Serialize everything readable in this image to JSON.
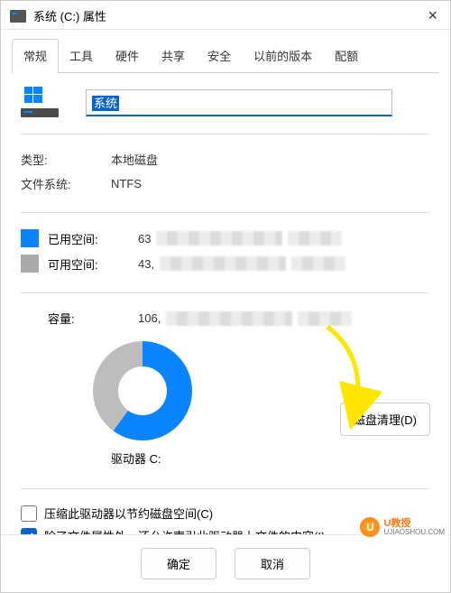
{
  "title": "系统 (C:) 属性",
  "tabs": [
    "常规",
    "工具",
    "硬件",
    "共享",
    "安全",
    "以前的版本",
    "配额"
  ],
  "active_tab": "常规",
  "name_field": {
    "value": "系统"
  },
  "type_row": {
    "label": "类型:",
    "value": "本地磁盘"
  },
  "fs_row": {
    "label": "文件系统:",
    "value": "NTFS"
  },
  "used_space": {
    "label": "已用空间:",
    "value_prefix": "63"
  },
  "free_space": {
    "label": "可用空间:",
    "value_prefix": "43,"
  },
  "capacity": {
    "label": "容量:",
    "value_prefix": "106,"
  },
  "drive_label": "驱动器 C:",
  "disk_cleanup": "磁盘清理(D)",
  "compress_check": {
    "checked": false,
    "label": "压缩此驱动器以节约磁盘空间(C)"
  },
  "index_check": {
    "checked": true,
    "label": "除了文件属性外，还允许索引此驱动器上文件的内容(I)"
  },
  "ok_btn": "确定",
  "cancel_btn": "取消",
  "watermark": {
    "brand": "U教授",
    "url": "UJIAOSHOU.COM"
  },
  "chart_data": {
    "type": "pie",
    "title": "驱动器 C:",
    "series": [
      {
        "name": "已用空间",
        "value": 63,
        "color": "#0a84ff"
      },
      {
        "name": "可用空间",
        "value": 43,
        "color": "#bdbdbd"
      }
    ]
  }
}
